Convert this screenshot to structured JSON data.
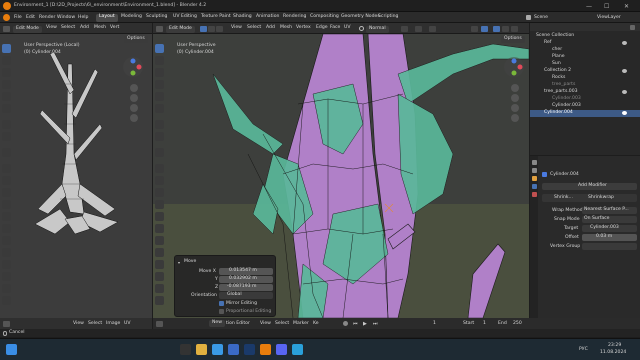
{
  "window": {
    "title": "Environment_1 [D:\\2D_Projects\\6\\_environment\\Environment_1.blend] - Blender 4.2",
    "minimize": "—",
    "maximize": "☐",
    "close": "✕"
  },
  "menubar": {
    "items": [
      "File",
      "Edit",
      "Render",
      "Window",
      "Help"
    ],
    "workspaces": [
      "Layout",
      "Modeling",
      "Sculpting",
      "UV Editing",
      "Texture Paint",
      "Shading",
      "Animation",
      "Rendering",
      "Compositing",
      "Geometry Nodes",
      "Scripting"
    ],
    "active_workspace": "Layout",
    "scene_label": "Scene",
    "view_layer_label": "ViewLayer"
  },
  "left_viewport": {
    "mode": "Edit Mode",
    "menus": [
      "View",
      "Select",
      "Add",
      "Mesh",
      "Vert"
    ],
    "perspective": "User Perspective (Local)",
    "object": "(0) Cylinder.004",
    "options": "Options"
  },
  "main_viewport": {
    "mode": "Edit Mode",
    "menus": [
      "View",
      "Select",
      "Add",
      "Mesh",
      "Vertex",
      "Edge",
      "Face",
      "UV"
    ],
    "transform_orientation": "Normal",
    "perspective": "User Perspective",
    "object": "(0) Cylinder.004",
    "options": "Options"
  },
  "move_panel": {
    "title": "Move",
    "move_x_label": "Move X",
    "y_label": "Y",
    "z_label": "Z",
    "move_x": "0.013547 m",
    "move_y": "0.032902 m",
    "move_z": "-0.087193 m",
    "orientation_label": "Orientation",
    "orientation": "Global",
    "mirror_editing": "Mirror Editing",
    "proportional_editing": "Proportional Editing"
  },
  "outliner": {
    "header": "Scene Collection",
    "rows": [
      {
        "label": "Scene Collection",
        "indent": 0,
        "selected": false
      },
      {
        "label": "Ref",
        "indent": 1,
        "selected": false
      },
      {
        "label": "cher",
        "indent": 2,
        "selected": false
      },
      {
        "label": "Plane",
        "indent": 2,
        "selected": false
      },
      {
        "label": "Sun",
        "indent": 2,
        "selected": false
      },
      {
        "label": "Collection 2",
        "indent": 1,
        "selected": false
      },
      {
        "label": "Rocks",
        "indent": 2,
        "selected": false
      },
      {
        "label": "tree_parts",
        "indent": 2,
        "selected": false
      },
      {
        "label": "tree_parts.003",
        "indent": 1,
        "selected": false
      },
      {
        "label": "Cylinder.003",
        "indent": 2,
        "selected": false
      },
      {
        "label": "Cylinder.003",
        "indent": 2,
        "selected": false
      },
      {
        "label": "Cylinder.004",
        "indent": 1,
        "selected": true
      }
    ]
  },
  "properties": {
    "object": "Cylinder.004",
    "modifier_name": "Shrinkwrap",
    "add_modifier": "Add Modifier",
    "modifier_field": "Shrink...",
    "wrap_method_label": "Wrap Method",
    "wrap_method": "Nearest Surface P...",
    "snap_mode_label": "Snap Mode",
    "snap_mode": "On Surface",
    "target_label": "Target",
    "target": "Cylinder.003",
    "offset_label": "Offset",
    "offset": "0.03 m",
    "vertex_group_label": "Vertex Group"
  },
  "left_footer": {
    "menus": [
      "View",
      "Select",
      "Image",
      "UV"
    ]
  },
  "timeline": {
    "mode": "New",
    "editor": "tion Editor",
    "menus": [
      "View",
      "Select",
      "Marker",
      "Ke"
    ],
    "playback": "Playback",
    "keying": "Keying",
    "view": "View",
    "marker": "Marker",
    "start_label": "Start",
    "start": "1",
    "end_label": "End",
    "end": "250",
    "current_frame": "1"
  },
  "status": {
    "left": "Cancel"
  },
  "taskbar": {
    "time": "23:29",
    "date": "11.08.2024",
    "lang": "РУС"
  },
  "colors": {
    "accent": "#4772b3",
    "mesh_purple": "#b080c8",
    "mesh_green": "#5ab89a",
    "axis_x": "#e04a5a",
    "axis_y": "#7ab83a",
    "axis_z": "#4a7ae0"
  }
}
